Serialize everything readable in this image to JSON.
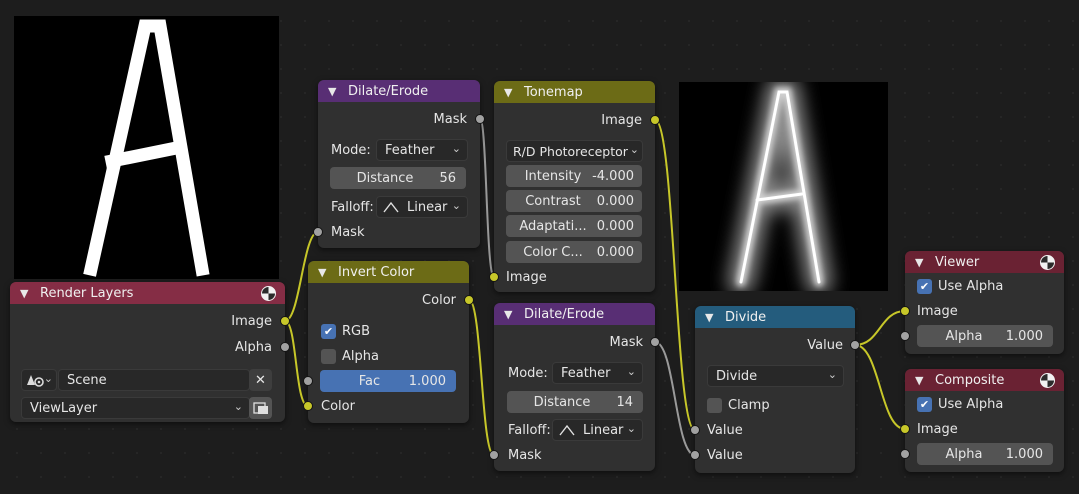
{
  "render_layers": {
    "title": "Render Layers",
    "outputs": {
      "image": "Image",
      "alpha": "Alpha"
    },
    "scene": "Scene",
    "view_layer": "ViewLayer",
    "clear_glyph": "✕"
  },
  "dilate_erode_1": {
    "title": "Dilate/Erode",
    "output": "Mask",
    "mode_label": "Mode:",
    "mode_value": "Feather",
    "distance_label": "Distance",
    "distance_value": "56",
    "falloff_label": "Falloff:",
    "falloff_value": "Linear",
    "input": "Mask"
  },
  "invert_color": {
    "title": "Invert Color",
    "output": "Color",
    "rgb_label": "RGB",
    "rgb_checked": true,
    "alpha_label": "Alpha",
    "alpha_checked": false,
    "fac_label": "Fac",
    "fac_value": "1.000",
    "input": "Color"
  },
  "tonemap": {
    "title": "Tonemap",
    "output": "Image",
    "type_value": "R/D Photoreceptor",
    "fields": [
      {
        "label": "Intensity",
        "value": "-4.000"
      },
      {
        "label": "Contrast",
        "value": "0.000"
      },
      {
        "label": "Adaptati...",
        "value": "0.000"
      },
      {
        "label": "Color C...",
        "value": "0.000"
      }
    ],
    "input": "Image"
  },
  "dilate_erode_2": {
    "title": "Dilate/Erode",
    "output": "Mask",
    "mode_label": "Mode:",
    "mode_value": "Feather",
    "distance_label": "Distance",
    "distance_value": "14",
    "falloff_label": "Falloff:",
    "falloff_value": "Linear",
    "input": "Mask"
  },
  "divide": {
    "title": "Divide",
    "output": "Value",
    "operation": "Divide",
    "clamp_label": "Clamp",
    "clamp_checked": false,
    "inputs": [
      "Value",
      "Value"
    ]
  },
  "viewer": {
    "title": "Viewer",
    "use_alpha_label": "Use Alpha",
    "use_alpha_checked": true,
    "input": "Image",
    "alpha_label": "Alpha",
    "alpha_value": "1.000"
  },
  "composite": {
    "title": "Composite",
    "use_alpha_label": "Use Alpha",
    "use_alpha_checked": true,
    "input": "Image",
    "alpha_label": "Alpha",
    "alpha_value": "1.000"
  },
  "colors": {
    "socket_color": "#c7c729",
    "socket_float": "#a1a1a1",
    "wire_color": "#c7c729",
    "wire_float": "#9a9a9a",
    "header_input": "#852d45",
    "header_filter": "#582e74",
    "header_color": "#6c6b16",
    "header_converter": "#245c7d",
    "header_output": "#6a2233",
    "accent": "#4772b3"
  },
  "icons": {
    "chevron": "chevron-down-icon",
    "checkmark": "checkmark-icon",
    "globe": "globe-icon",
    "scene": "scene-icon",
    "clear": "clear-icon",
    "browse": "browse-view-layer-icon",
    "falloff": "linear-falloff-icon"
  }
}
